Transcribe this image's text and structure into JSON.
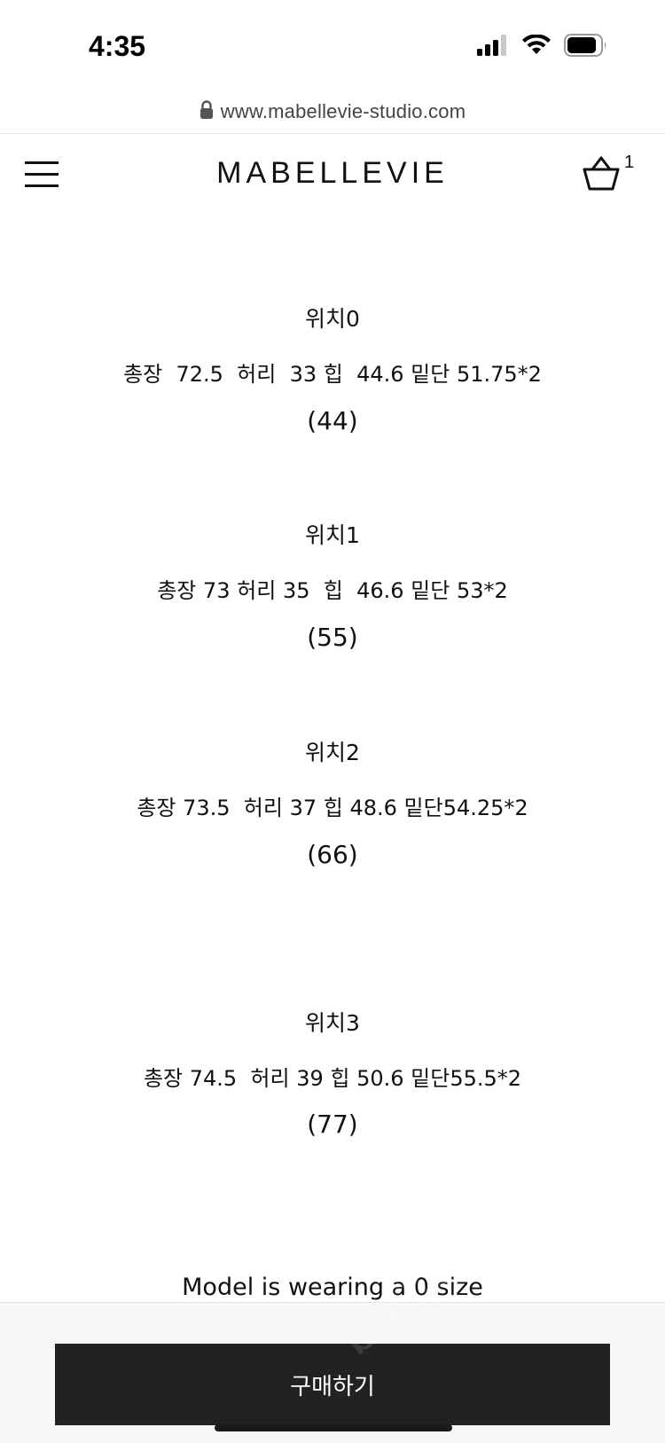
{
  "status_bar": {
    "time": "4:35",
    "icons": [
      "signal-icon",
      "wifi-icon",
      "battery-icon"
    ]
  },
  "browser": {
    "url": "www.mabellevie-studio.com",
    "lock_icon": "lock-icon"
  },
  "header": {
    "logo": "MABELLEVIE",
    "menu_icon": "hamburger-menu-icon",
    "cart_icon": "shopping-bag-icon",
    "cart_count": "1"
  },
  "size_guide": [
    {
      "label": "위치0",
      "measurements": "총장  72.5  허리  33 힙  44.6 밑단 51.75*2",
      "size": "(44)"
    },
    {
      "label": "위치1",
      "measurements": "총장 73 허리 35  힙  46.6 밑단 53*2",
      "size": "(55)"
    },
    {
      "label": "위치2",
      "measurements": "총장 73.5  허리 37 힙 48.6 밑단54.25*2",
      "size": "(66)"
    },
    {
      "label": "위치3",
      "measurements": "총장 74.5  허리 39 힙 50.6 밑단55.5*2",
      "size": "(77)"
    }
  ],
  "model_note": "Model is wearing a 0 size",
  "buy_button_label": "구매하기",
  "watermark": "bunjang",
  "colors": {
    "button_bg": "#222222",
    "text": "#111111",
    "bottom_bar_bg": "#f7f7f7"
  }
}
